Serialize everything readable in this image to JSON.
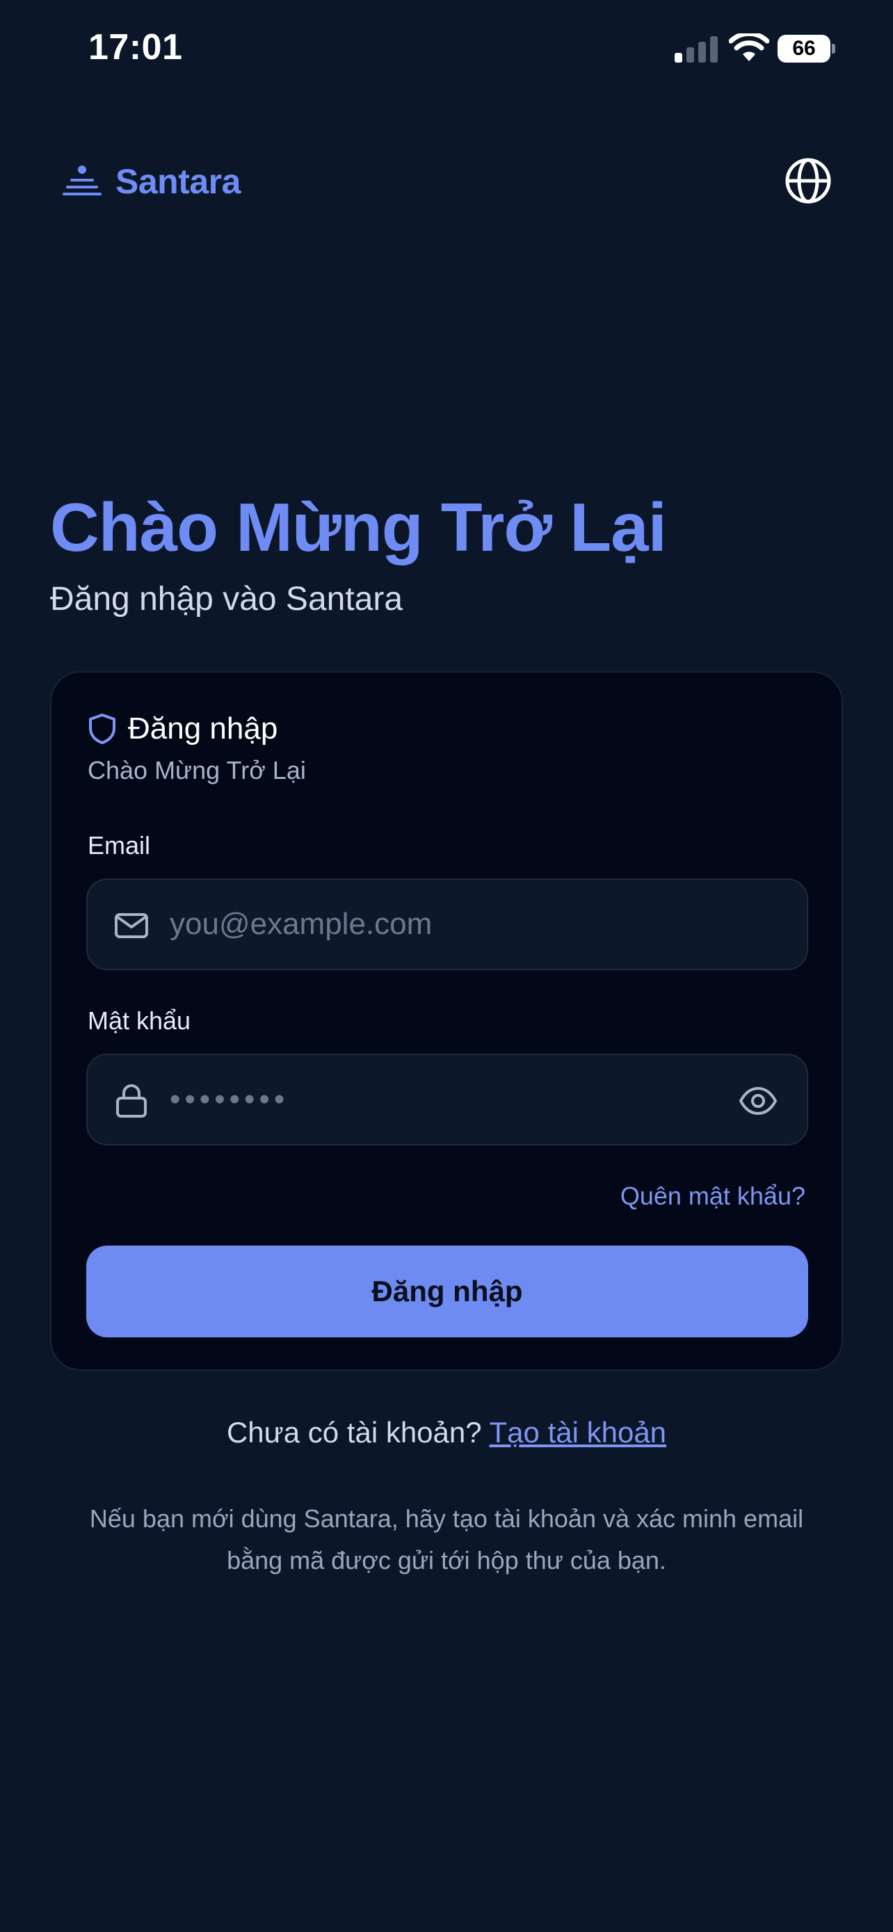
{
  "status_bar": {
    "time": "17:01",
    "battery": "66",
    "signal_icon": "signal-bars-icon",
    "wifi_icon": "wifi-icon"
  },
  "header": {
    "brand_name": "Santara",
    "logo_icon": "santara-logo-icon",
    "language_icon": "globe-icon"
  },
  "hero": {
    "title": "Chào Mừng Trở Lại",
    "subtitle": "Đăng nhập vào Santara"
  },
  "card": {
    "title": "Đăng nhập",
    "title_icon": "shield-icon",
    "subtitle": "Chào Mừng Trở Lại",
    "email": {
      "label": "Email",
      "placeholder": "you@example.com",
      "value": "",
      "icon": "mail-icon"
    },
    "password": {
      "label": "Mật khẩu",
      "placeholder": "••••••••",
      "value": "",
      "icon": "lock-icon",
      "toggle_icon": "eye-icon"
    },
    "forgot_password": "Quên mật khẩu?",
    "submit_label": "Đăng nhập"
  },
  "footer": {
    "no_account_text": "Chưa có tài khoản? ",
    "create_account_link": "Tạo tài khoản",
    "info_text": "Nếu bạn mới dùng Santara, hãy tạo tài khoản và xác minh email bằng mã được gửi tới hộp thư của bạn."
  },
  "colors": {
    "background": "#0b1629",
    "card_background": "#020817",
    "accent": "#6e8bf2",
    "link": "#7e96f2",
    "input_background": "#0d1829"
  }
}
